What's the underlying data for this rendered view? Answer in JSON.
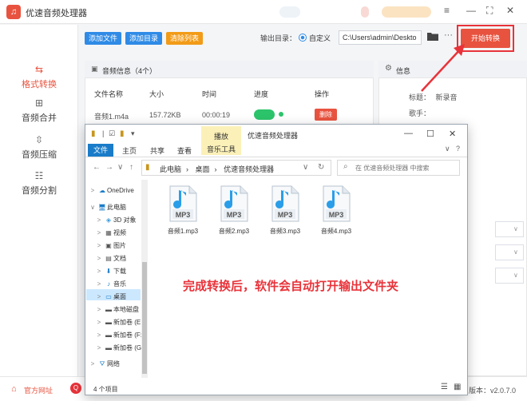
{
  "app": {
    "title": "优速音频处理器",
    "logo": "♫",
    "minimize": "—",
    "restore": "⛶",
    "close": "✕",
    "menu": "≡"
  },
  "sidebar": {
    "items": [
      {
        "label": "格式转换",
        "icon": "⇆",
        "active": true
      },
      {
        "label": "音频合并",
        "icon": "⊞",
        "active": false
      },
      {
        "label": "音频压缩",
        "icon": "⇳",
        "active": false
      },
      {
        "label": "音频分割",
        "icon": "☷",
        "active": false
      }
    ]
  },
  "toolbar": {
    "add_file": "添加文件",
    "add_folder": "添加目录",
    "clear_list": "清除列表",
    "output_dir_label": "输出目录：",
    "custom_label": "自定义",
    "output_path": "C:\\Users\\admin\\Deskto",
    "more": "···",
    "start": "开始转换"
  },
  "file_panel": {
    "title": "音频信息（4个）",
    "columns": [
      "文件名称",
      "大小",
      "时间",
      "进度",
      "操作"
    ],
    "row": {
      "name": "音频1.m4a",
      "size": "157.72KB",
      "time": "00:00:19",
      "delete": "删除"
    }
  },
  "info_panel": {
    "title": "信息",
    "title_label": "标题：",
    "title_value": "新录音",
    "singer_label": "歌手：",
    "select_caret": "∨"
  },
  "bottom": {
    "official_site": "官方网址",
    "version": "版本：v2.0.7.0"
  },
  "explorer": {
    "title": "优速音频处理器",
    "manage_tab": "播放",
    "ribbon_tabs": [
      "文件",
      "主页",
      "共享",
      "查看"
    ],
    "music_tools": "音乐工具",
    "address": [
      "此电脑",
      "桌面",
      "优速音频处理器"
    ],
    "search_placeholder": "在 优速音频处理器 中搜索",
    "tree": [
      {
        "label": "OneDrive",
        "icon": "☁",
        "color": "#1a7cc9",
        "indent": 0
      },
      {
        "label": "此电脑",
        "icon": "🖥",
        "color": "#1a7cc9",
        "indent": 0
      },
      {
        "label": "3D 对象",
        "icon": "◈",
        "color": "#3a9ad9",
        "indent": 1
      },
      {
        "label": "视频",
        "icon": "▦",
        "color": "#555",
        "indent": 1
      },
      {
        "label": "图片",
        "icon": "▣",
        "color": "#555",
        "indent": 1
      },
      {
        "label": "文档",
        "icon": "▤",
        "color": "#555",
        "indent": 1
      },
      {
        "label": "下载",
        "icon": "⬇",
        "color": "#1a7cc9",
        "indent": 1
      },
      {
        "label": "音乐",
        "icon": "♪",
        "color": "#1a7cc9",
        "indent": 1
      },
      {
        "label": "桌面",
        "icon": "▭",
        "color": "#1a7cc9",
        "indent": 1
      },
      {
        "label": "本地磁盘",
        "icon": "▬",
        "color": "#555",
        "indent": 1
      },
      {
        "label": "新加卷 (E:",
        "icon": "▬",
        "color": "#555",
        "indent": 1
      },
      {
        "label": "新加卷 (F:",
        "icon": "▬",
        "color": "#555",
        "indent": 1
      },
      {
        "label": "新加卷 (G",
        "icon": "▬",
        "color": "#555",
        "indent": 1
      },
      {
        "label": "网络",
        "icon": "⛛",
        "color": "#1a7cc9",
        "indent": 0
      }
    ],
    "files": [
      "音频1.mp3",
      "音频2.mp3",
      "音频3.mp3",
      "音频4.mp3"
    ],
    "file_badge": "MP3",
    "note": "完成转换后，软件会自动打开输出文件夹",
    "status": "4 个项目"
  },
  "colors": {
    "accent": "#e8533f",
    "blue": "#2f8be6",
    "orange": "#f29b18",
    "green": "#2cc46b"
  }
}
